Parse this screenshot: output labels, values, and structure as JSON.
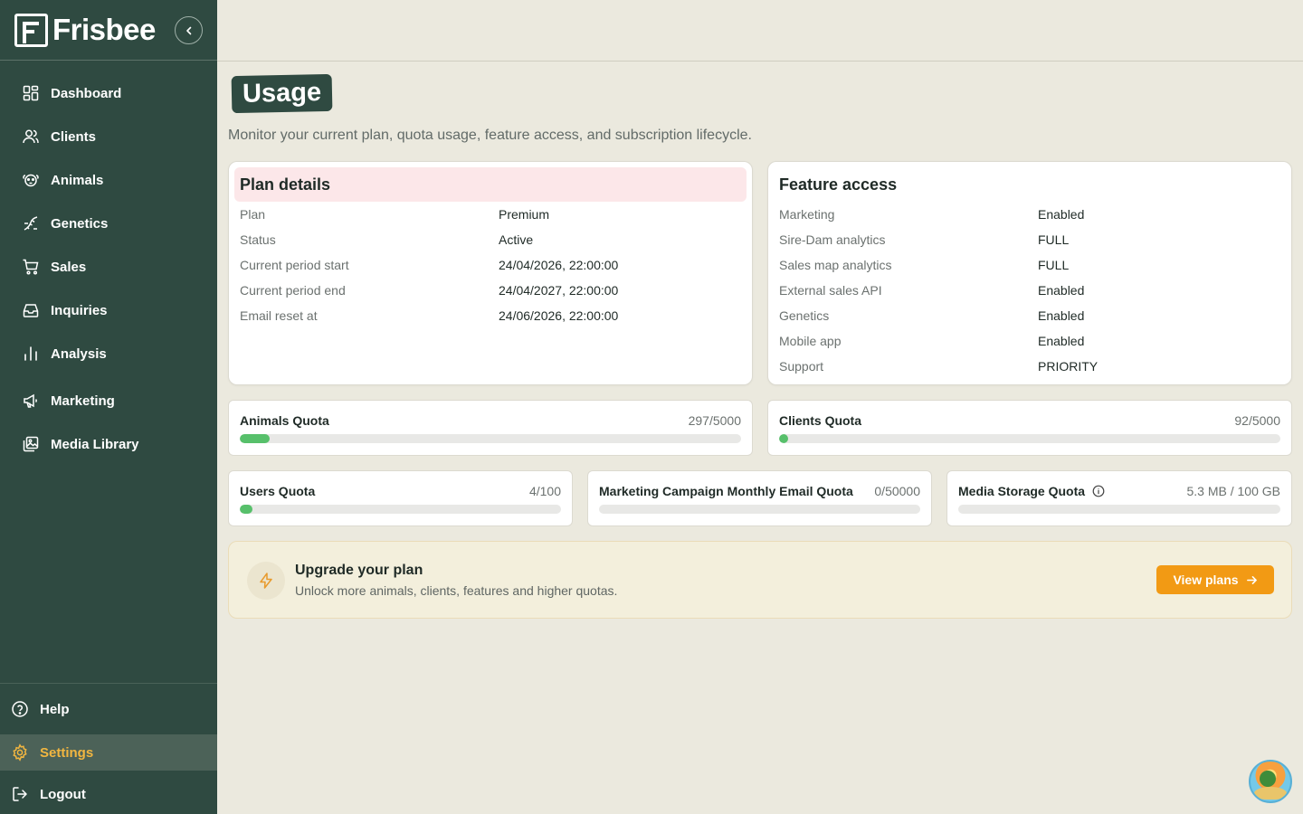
{
  "brand": {
    "name": "Frisbee"
  },
  "sidebar": {
    "items": [
      {
        "label": "Dashboard",
        "icon": "grid-icon"
      },
      {
        "label": "Clients",
        "icon": "users-icon"
      },
      {
        "label": "Animals",
        "icon": "animal-icon"
      },
      {
        "label": "Genetics",
        "icon": "genetics-icon"
      },
      {
        "label": "Sales",
        "icon": "cart-icon"
      },
      {
        "label": "Inquiries",
        "icon": "inbox-icon"
      },
      {
        "label": "Analysis",
        "icon": "bar-chart-icon"
      },
      {
        "label": "Marketing",
        "icon": "megaphone-icon"
      },
      {
        "label": "Media Library",
        "icon": "images-icon"
      }
    ],
    "bottom": {
      "help": "Help",
      "settings": "Settings",
      "logout": "Logout"
    }
  },
  "page": {
    "title": "Usage",
    "subtitle": "Monitor your current plan, quota usage, feature access, and subscription lifecycle."
  },
  "plan_details": {
    "title": "Plan details",
    "rows": [
      {
        "key": "Plan",
        "value": "Premium"
      },
      {
        "key": "Status",
        "value": "Active"
      },
      {
        "key": "Current period start",
        "value": "24/04/2026, 22:00:00"
      },
      {
        "key": "Current period end",
        "value": "24/04/2027, 22:00:00"
      },
      {
        "key": "Email reset at",
        "value": "24/06/2026, 22:00:00"
      }
    ]
  },
  "feature_access": {
    "title": "Feature access",
    "rows": [
      {
        "key": "Marketing",
        "value": "Enabled"
      },
      {
        "key": "Sire-Dam analytics",
        "value": "FULL"
      },
      {
        "key": "Sales map analytics",
        "value": "FULL"
      },
      {
        "key": "External sales API",
        "value": "Enabled"
      },
      {
        "key": "Genetics",
        "value": "Enabled"
      },
      {
        "key": "Mobile app",
        "value": "Enabled"
      },
      {
        "key": "Support",
        "value": "PRIORITY"
      }
    ]
  },
  "quotas": {
    "animals": {
      "label": "Animals Quota",
      "value": "297/5000",
      "fill_pct": 5.94
    },
    "clients": {
      "label": "Clients Quota",
      "value": "92/5000",
      "fill_pct": 1.84
    },
    "users": {
      "label": "Users Quota",
      "value": "4/100",
      "fill_pct": 4
    },
    "email": {
      "label": "Marketing Campaign Monthly Email Quota",
      "value": "0/50000",
      "fill_pct": 0
    },
    "media": {
      "label": "Media Storage Quota",
      "value": "5.3 MB / 100 GB",
      "fill_pct": 0.005
    }
  },
  "upgrade": {
    "title": "Upgrade your plan",
    "subtitle": "Unlock more animals, clients, features and higher quotas.",
    "button": "View plans"
  },
  "colors": {
    "sidebar": "#2f4a41",
    "accent": "#f29a14",
    "active_text": "#f2b640",
    "progress": "#57c06b"
  }
}
